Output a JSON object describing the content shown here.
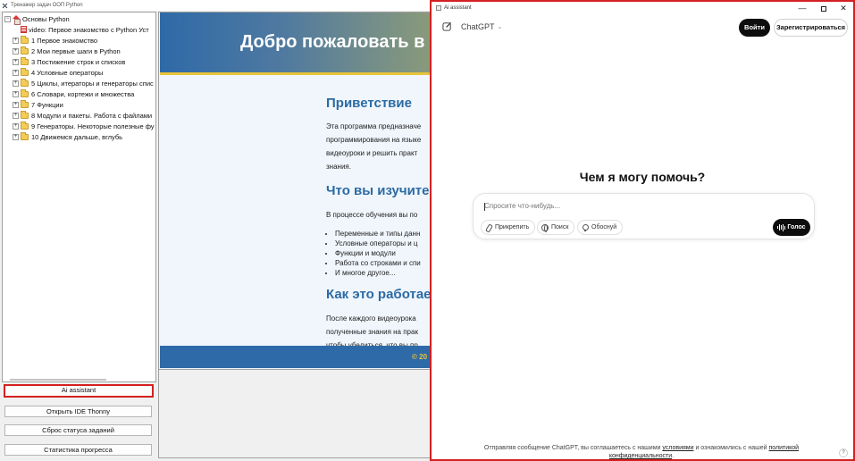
{
  "main_window": {
    "title": "Тренажер задач ООП Python"
  },
  "tree": {
    "root_label": "Основы Python",
    "video_label": "video: Первое знакомство с Python  Уст",
    "items": [
      "1 Первое знакомство",
      "2 Мои первые шаги в Python",
      "3 Постижение строк и списков",
      "4 Условные операторы",
      "5 Циклы, итераторы и генераторы спис",
      "6 Словари, кортежи и множества",
      "7 Функции",
      "8 Модули и пакеты. Работа с файлами",
      "9 Генераторы. Некоторые полезные фу",
      "10 Движемся дальше, вглубь"
    ]
  },
  "side_buttons": {
    "ai_assistant": "Ai assistant",
    "open_ide": "Открыть IDE Thonny",
    "reset_status": "Сброс статуса заданий",
    "progress_stats": "Статистика прогресса"
  },
  "content": {
    "hero_title": "Добро пожаловать в",
    "greeting_heading": "Приветствие",
    "greeting_lines": [
      "Эта программа предназначе",
      "программирования на языке",
      "видеоуроки и решить практ",
      "знания."
    ],
    "learn_heading": "Что вы изучите",
    "learn_intro": "В процессе обучения вы по",
    "learn_items": [
      "Переменные и типы данн",
      "Условные операторы и ц",
      "Функции и модули",
      "Работа со строками и спи",
      "И многое другое..."
    ],
    "how_heading": "Как это работает",
    "how_lines": [
      "После каждого видеоурока",
      "полученные знания на прак",
      "чтобы убедиться, что вы пр"
    ],
    "footer_text": "© 20"
  },
  "ai_window": {
    "title": "Ai assistant",
    "controls": {
      "minimize": "—",
      "close": "✕"
    },
    "model_name": "ChatGPT",
    "login_label": "Войти",
    "signup_label": "Зарегистрироваться",
    "heading": "Чем я могу помочь?",
    "input_placeholder": "Спросите что-нибудь...",
    "chips": {
      "attach": "Прикрепить",
      "search": "Поиск",
      "reason": "Обоснуй"
    },
    "voice_label": "Голос",
    "disclaimer": {
      "text1": "Отправляя сообщение ChatGPT, вы соглашаетесь с нашими ",
      "link_terms": "условиями",
      "text2": " и ознакомились с нашей ",
      "link_privacy1": "политикой",
      "link_privacy2": "конфиденциальности",
      "text3": "."
    },
    "help_label": "?"
  },
  "colors": {
    "highlight_border": "#d42020",
    "heading_blue": "#2c6aa3",
    "footer_gold": "#e7c43a"
  }
}
